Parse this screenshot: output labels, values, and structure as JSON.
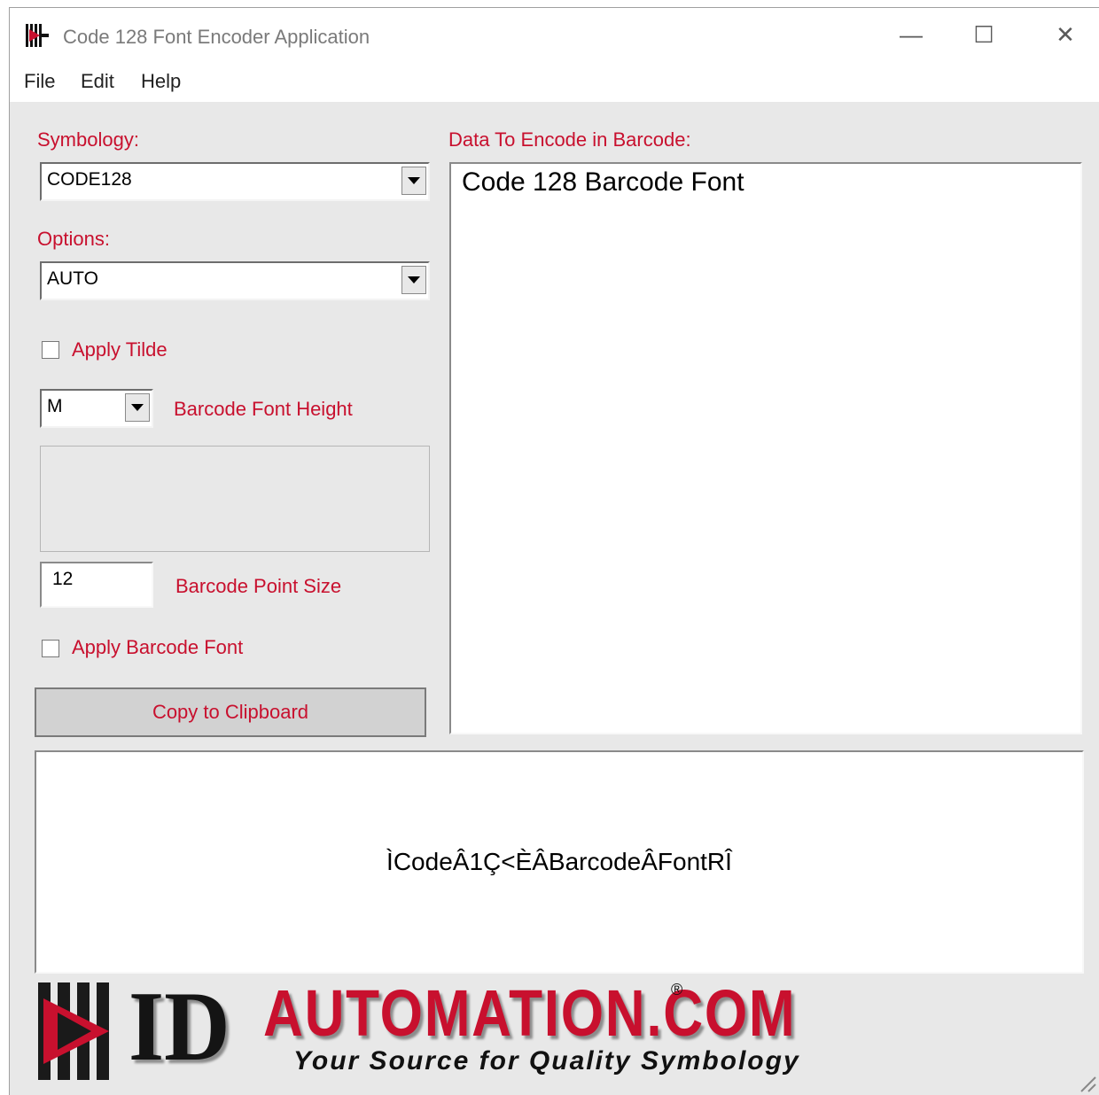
{
  "window": {
    "title": "Code 128 Font Encoder Application",
    "controls": {
      "minimize": "—",
      "maximize": "☐",
      "close": "✕"
    }
  },
  "menu": {
    "items": [
      "File",
      "Edit",
      "Help"
    ]
  },
  "left_panel": {
    "symbology_label": "Symbology:",
    "symbology_value": "CODE128",
    "options_label": "Options:",
    "options_value": "AUTO",
    "apply_tilde_label": "Apply Tilde",
    "apply_tilde_checked": false,
    "font_height_value": "M",
    "font_height_label": "Barcode Font Height",
    "point_size_value": "12",
    "point_size_label": "Barcode Point Size",
    "apply_barcode_font_label": "Apply Barcode Font",
    "apply_barcode_font_checked": false,
    "copy_button_label": "Copy to Clipboard"
  },
  "data_panel": {
    "label": "Data To Encode in Barcode:",
    "value": "Code 128 Barcode Font"
  },
  "output": {
    "encoded_text": "ÌCodeÂ1Ç<ÈÂBarcodeÂFontRÎ"
  },
  "logo": {
    "id_text": "ID",
    "main_text": "AUTOMATION.COM",
    "registered_mark": "®",
    "tagline": "Your Source for Quality Symbology",
    "colors": {
      "red": "#c8102e",
      "dark": "#141414"
    }
  }
}
